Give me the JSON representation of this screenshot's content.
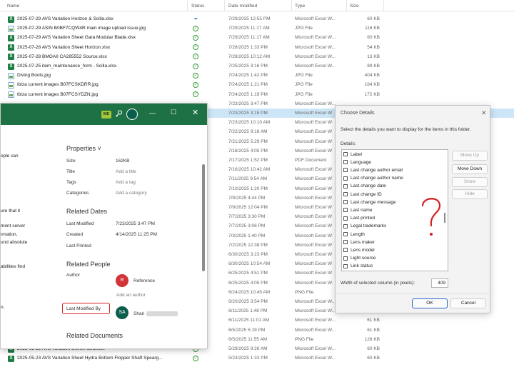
{
  "explorer": {
    "headers": {
      "name": "Name",
      "status": "Status",
      "date": "Date modified",
      "type": "Type",
      "size": "Size"
    },
    "rows": [
      {
        "name": "2025-07-29 AVS Variation Horizon & Scilla.xlsx",
        "status": "cloud",
        "date": "7/29/2025 12:55 PM",
        "type": "Microsoft Excel W...",
        "size": "60 KB",
        "icon": "excel"
      },
      {
        "name": "2025-07-29 ASIN B0BF7CQW4R main image upload issue.jpg",
        "status": "check",
        "date": "7/29/2025 11:17 AM",
        "type": "JPG File",
        "size": "116 KB",
        "icon": "jpg"
      },
      {
        "name": "2025-07-29 AVS Variation Sheet Gara Modular Blade.xlsx",
        "status": "check",
        "date": "7/29/2025 11:17 AM",
        "type": "Microsoft Excel W...",
        "size": "60 KB",
        "icon": "excel"
      },
      {
        "name": "2025-07-28 AVS Variation Sheet Horizon.xlsx",
        "status": "check",
        "date": "7/28/2025 1:33 PM",
        "type": "Microsoft Excel W...",
        "size": "54 KB",
        "icon": "excel"
      },
      {
        "name": "2025-07-28 BMOAII CA285552 Source.xlsx",
        "status": "check",
        "date": "7/28/2025 10:12 AM",
        "type": "Microsoft Excel W...",
        "size": "13 KB",
        "icon": "excel"
      },
      {
        "name": "2025-07-25 item_maintenance_form - Scilla.xlsx",
        "status": "check",
        "date": "7/25/2025 3:16 PM",
        "type": "Microsoft Excel W...",
        "size": "89 KB",
        "icon": "excel"
      },
      {
        "name": "Diving Boots.jpg",
        "status": "check",
        "date": "7/24/2025 1:42 PM",
        "type": "JPG File",
        "size": "404 KB",
        "icon": "jpg"
      },
      {
        "name": "Ibiza current images B07FCSKDRR.jpg",
        "status": "check",
        "date": "7/24/2025 1:21 PM",
        "type": "JPG File",
        "size": "164 KB",
        "icon": "jpg"
      },
      {
        "name": "Ibiza current images B07FCSYDZN.jpg",
        "status": "check",
        "date": "7/24/2025 1:19 PM",
        "type": "JPG File",
        "size": "172 KB",
        "icon": "jpg"
      },
      {
        "name": "",
        "status": "",
        "date": "7/23/2025 3:47 PM",
        "type": "Microsoft Excel W...",
        "size": "",
        "icon": ""
      },
      {
        "name": "",
        "status": "",
        "date": "7/23/2025 3:15 PM",
        "type": "Microsoft Excel W",
        "size": "",
        "icon": "",
        "selected": true
      },
      {
        "name": "",
        "status": "",
        "date": "7/23/2025 10:10 AM",
        "type": "Microsoft Excel W",
        "size": "",
        "icon": ""
      },
      {
        "name": "",
        "status": "",
        "date": "7/22/2025 9:18 AM",
        "type": "Microsoft Excel W",
        "size": "",
        "icon": ""
      },
      {
        "name": "",
        "status": "",
        "date": "7/21/2025 5:29 PM",
        "type": "Microsoft Excel W",
        "size": "",
        "icon": ""
      },
      {
        "name": "",
        "status": "",
        "date": "7/18/2025 4:05 PM",
        "type": "Microsoft Excel W",
        "size": "",
        "icon": ""
      },
      {
        "name": "",
        "status": "",
        "date": "7/17/2025 1:52 PM",
        "type": "PDF Document",
        "size": "",
        "icon": ""
      },
      {
        "name": "",
        "status": "",
        "date": "7/16/2025 10:42 AM",
        "type": "Microsoft Excel W",
        "size": "",
        "icon": ""
      },
      {
        "name": "",
        "status": "",
        "date": "7/11/2025 9:54 AM",
        "type": "Microsoft Excel W",
        "size": "",
        "icon": ""
      },
      {
        "name": "",
        "status": "",
        "date": "7/10/2025 1:20 PM",
        "type": "Microsoft Excel W",
        "size": "",
        "icon": ""
      },
      {
        "name": "",
        "status": "",
        "date": "7/9/2025 4:44 PM",
        "type": "Microsoft Excel W",
        "size": "",
        "icon": ""
      },
      {
        "name": "",
        "status": "",
        "date": "7/9/2025 12:04 PM",
        "type": "Microsoft Excel W",
        "size": "",
        "icon": ""
      },
      {
        "name": "",
        "status": "",
        "date": "7/7/2025 3:30 PM",
        "type": "Microsoft Excel W",
        "size": "",
        "icon": ""
      },
      {
        "name": "",
        "status": "",
        "date": "7/7/2025 3:06 PM",
        "type": "Microsoft Excel W",
        "size": "",
        "icon": ""
      },
      {
        "name": "",
        "status": "",
        "date": "7/3/2025 1:40 PM",
        "type": "Microsoft Excel W",
        "size": "",
        "icon": ""
      },
      {
        "name": "",
        "status": "",
        "date": "7/2/2025 12:38 PM",
        "type": "Microsoft Excel W",
        "size": "",
        "icon": ""
      },
      {
        "name": "",
        "status": "",
        "date": "6/30/2025 3:23 PM",
        "type": "Microsoft Excel W",
        "size": "",
        "icon": ""
      },
      {
        "name": "",
        "status": "",
        "date": "6/30/2025 10:54 AM",
        "type": "Microsoft Excel W",
        "size": "",
        "icon": ""
      },
      {
        "name": "",
        "status": "",
        "date": "6/25/2025 4:51 PM",
        "type": "Microsoft Excel W",
        "size": "",
        "icon": ""
      },
      {
        "name": "",
        "status": "",
        "date": "6/25/2025 4:05 PM",
        "type": "Microsoft Excel W",
        "size": "",
        "icon": ""
      },
      {
        "name": "",
        "status": "",
        "date": "6/24/2025 10:45 AM",
        "type": "PNG File",
        "size": "",
        "icon": ""
      },
      {
        "name": "",
        "status": "",
        "date": "6/20/2025 3:54 PM",
        "type": "Microsoft Excel W...",
        "size": "62 KB",
        "icon": ""
      },
      {
        "name": "",
        "status": "",
        "date": "6/11/2025 1:48 PM",
        "type": "Microsoft Excel W...",
        "size": "61 KB",
        "icon": ""
      },
      {
        "name": "",
        "status": "",
        "date": "6/11/2025 11:01 AM",
        "type": "Microsoft Excel W...",
        "size": "61 KB",
        "icon": ""
      },
      {
        "name": "2025-06-05 AVS Variation Ranger.xlsx",
        "status": "check",
        "date": "6/5/2025 5:19 PM",
        "type": "Microsoft Excel W...",
        "size": "61 KB",
        "icon": "excel"
      },
      {
        "name": "2025-06-05 SKU Not Updated FG Pole Spear.png",
        "status": "check",
        "date": "6/5/2025 11:55 AM",
        "type": "PNG File",
        "size": "128 KB",
        "icon": "jpg"
      },
      {
        "name": "2025-05-29 AVS Variation Sheet Astra.xlsx",
        "status": "check",
        "date": "5/29/2025 9:26 AM",
        "type": "Microsoft Excel W...",
        "size": "60 KB",
        "icon": "excel"
      },
      {
        "name": "2025-05-23 AVS Variation Sheet Hydra Bottom Flopper Shaft Spearg...",
        "status": "check",
        "date": "5/23/2025 1:33 PM",
        "type": "Microsoft Excel W...",
        "size": "60 KB",
        "icon": "excel"
      }
    ]
  },
  "excel": {
    "me_badge": "ME",
    "left_texts": [
      "ople can",
      "ure that it",
      "ment server",
      "rmation,",
      "und absolute",
      "abilities find",
      "n."
    ],
    "properties": {
      "title": "Properties ˅",
      "rows": [
        {
          "label": "Size",
          "value": "162KB",
          "muted": false
        },
        {
          "label": "Title",
          "value": "Add a title",
          "muted": true
        },
        {
          "label": "Tags",
          "value": "Add a tag",
          "muted": true
        },
        {
          "label": "Categories",
          "value": "Add a category",
          "muted": true
        }
      ]
    },
    "related_dates": {
      "title": "Related Dates",
      "rows": [
        {
          "label": "Last Modified",
          "value": "7/23/2025 3:47 PM"
        },
        {
          "label": "Created",
          "value": "4/14/2025 11:25 PM"
        },
        {
          "label": "Last Printed",
          "value": ""
        }
      ]
    },
    "related_people": {
      "title": "Related People",
      "author_label": "Author",
      "author_initial": "R",
      "author_name": "Reference",
      "add_author": "Add an author",
      "last_modified_by_label": "Last Modified By",
      "modifier_initials": "SA",
      "modifier_name": "Shari"
    },
    "related_documents": {
      "title": "Related Documents"
    },
    "colors": {
      "title_bar": "#1e7145",
      "author_avatar": "#d13438",
      "modifier_avatar": "#0a5e4c"
    }
  },
  "dialog": {
    "title": "Choose Details",
    "instruction": "Select the details you want to display for the items in this folder.",
    "details_label": "Details:",
    "items": [
      "Label",
      "Language",
      "Last change author email",
      "Last change author name",
      "Last change date",
      "Last change ID",
      "Last change message",
      "Last name",
      "Last printed",
      "Legal trademarks",
      "Length",
      "Lens maker",
      "Lens model",
      "Light source",
      "Link status"
    ],
    "buttons": {
      "move_up": "Move Up",
      "move_down": "Move Down",
      "show": "Show",
      "hide": "Hide",
      "ok": "OK",
      "cancel": "Cancel"
    },
    "width_label": "Width of selected column (in pixels):",
    "width_value": "409"
  }
}
